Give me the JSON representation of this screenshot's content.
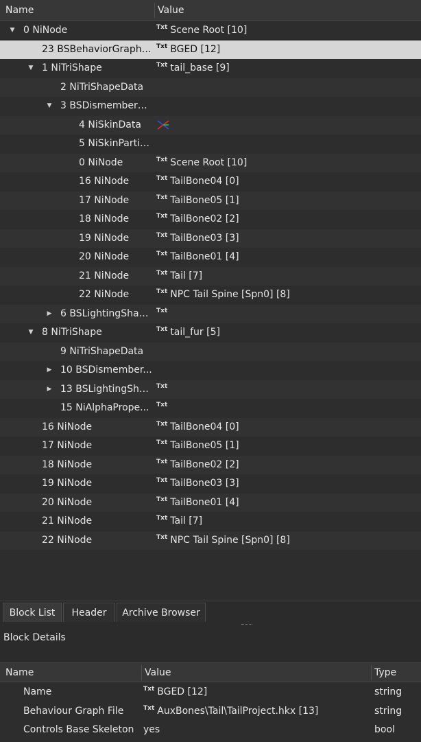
{
  "tree": {
    "col_name": "Name",
    "col_value": "Value",
    "rows": [
      {
        "level": 0,
        "arrow": "down",
        "name": "0 NiNode",
        "icon": "Txt",
        "value": "Scene Root [10]"
      },
      {
        "level": 1,
        "arrow": "",
        "name": "23 BSBehaviorGraphE...",
        "icon": "Txt",
        "value": "BGED [12]",
        "selected": true
      },
      {
        "level": 1,
        "arrow": "down",
        "name": "1 NiTriShape",
        "icon": "Txt",
        "value": "tail_base [9]"
      },
      {
        "level": 2,
        "arrow": "",
        "name": "2 NiTriShapeData",
        "icon": "",
        "value": ""
      },
      {
        "level": 2,
        "arrow": "down",
        "name": "3 BSDismemberS...",
        "icon": "",
        "value": ""
      },
      {
        "level": 3,
        "arrow": "",
        "name": "4 NiSkinData",
        "icon": "skin",
        "value": ""
      },
      {
        "level": 3,
        "arrow": "",
        "name": "5 NiSkinPartiti...",
        "icon": "",
        "value": ""
      },
      {
        "level": 3,
        "arrow": "",
        "name": "0 NiNode",
        "icon": "Txt",
        "value": "Scene Root [10]"
      },
      {
        "level": 3,
        "arrow": "",
        "name": "16 NiNode",
        "icon": "Txt",
        "value": "TailBone04 [0]"
      },
      {
        "level": 3,
        "arrow": "",
        "name": "17 NiNode",
        "icon": "Txt",
        "value": "TailBone05 [1]"
      },
      {
        "level": 3,
        "arrow": "",
        "name": "18 NiNode",
        "icon": "Txt",
        "value": "TailBone02 [2]"
      },
      {
        "level": 3,
        "arrow": "",
        "name": "19 NiNode",
        "icon": "Txt",
        "value": "TailBone03 [3]"
      },
      {
        "level": 3,
        "arrow": "",
        "name": "20 NiNode",
        "icon": "Txt",
        "value": "TailBone01 [4]"
      },
      {
        "level": 3,
        "arrow": "",
        "name": "21 NiNode",
        "icon": "Txt",
        "value": "Tail [7]"
      },
      {
        "level": 3,
        "arrow": "",
        "name": "22 NiNode",
        "icon": "Txt",
        "value": "NPC Tail Spine [Spn0] [8]"
      },
      {
        "level": 2,
        "arrow": "right",
        "name": "6 BSLightingShad...",
        "icon": "Txt",
        "value": ""
      },
      {
        "level": 1,
        "arrow": "down",
        "name": "8 NiTriShape",
        "icon": "Txt",
        "value": "tail_fur [5]"
      },
      {
        "level": 2,
        "arrow": "",
        "name": "9 NiTriShapeData",
        "icon": "",
        "value": ""
      },
      {
        "level": 2,
        "arrow": "right",
        "name": "10 BSDismember...",
        "icon": "",
        "value": ""
      },
      {
        "level": 2,
        "arrow": "right",
        "name": "13 BSLightingSha...",
        "icon": "Txt",
        "value": ""
      },
      {
        "level": 2,
        "arrow": "",
        "name": "15 NiAlphaPrope...",
        "icon": "Txt",
        "value": ""
      },
      {
        "level": 1,
        "arrow": "",
        "name": "16 NiNode",
        "icon": "Txt",
        "value": "TailBone04 [0]"
      },
      {
        "level": 1,
        "arrow": "",
        "name": "17 NiNode",
        "icon": "Txt",
        "value": "TailBone05 [1]"
      },
      {
        "level": 1,
        "arrow": "",
        "name": "18 NiNode",
        "icon": "Txt",
        "value": "TailBone02 [2]"
      },
      {
        "level": 1,
        "arrow": "",
        "name": "19 NiNode",
        "icon": "Txt",
        "value": "TailBone03 [3]"
      },
      {
        "level": 1,
        "arrow": "",
        "name": "20 NiNode",
        "icon": "Txt",
        "value": "TailBone01 [4]"
      },
      {
        "level": 1,
        "arrow": "",
        "name": "21 NiNode",
        "icon": "Txt",
        "value": "Tail [7]"
      },
      {
        "level": 1,
        "arrow": "",
        "name": "22 NiNode",
        "icon": "Txt",
        "value": "NPC Tail Spine [Spn0] [8]"
      }
    ]
  },
  "tabs": [
    {
      "label": "Block List",
      "active": true
    },
    {
      "label": "Header",
      "active": false
    },
    {
      "label": "Archive Browser",
      "active": false
    }
  ],
  "details": {
    "title": "Block Details",
    "col_name": "Name",
    "col_value": "Value",
    "col_type": "Type",
    "rows": [
      {
        "name": "Name",
        "icon": "Txt",
        "value": "BGED [12]",
        "type": "string"
      },
      {
        "name": "Behaviour Graph File",
        "icon": "Txt",
        "value": "AuxBones\\Tail\\TailProject.hkx [13]",
        "type": "string"
      },
      {
        "name": "Controls Base Skeleton",
        "icon": "",
        "value": "yes",
        "type": "bool"
      }
    ]
  }
}
